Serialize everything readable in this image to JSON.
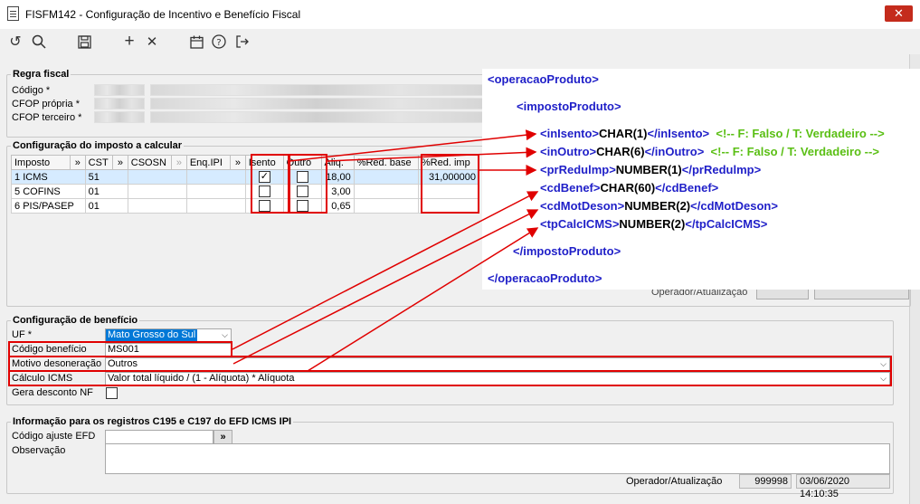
{
  "window": {
    "title": "FISFM142 - Configuração de Incentivo e Benefício Fiscal",
    "close_glyph": "✕"
  },
  "toolbar": {
    "undo": "↺",
    "search": "⚲",
    "save": "💾",
    "add": "+",
    "delete": "✕",
    "calendar": "📅",
    "help": "?",
    "exit": "⇥"
  },
  "regra": {
    "title": "Regra fiscal",
    "codigo_label": "Código *",
    "cfop_propria_label": "CFOP própria *",
    "cfop_terceiro_label": "CFOP terceiro *"
  },
  "imposto": {
    "title": "Configuração do imposto a calcular",
    "columns": [
      "Imposto",
      "»",
      "CST",
      "»",
      "CSOSN",
      "»",
      "Enq.IPI",
      "»",
      "Isento",
      "Outro",
      "Aliq.",
      "%Red. base",
      "%Red. imp"
    ],
    "rows": [
      {
        "n": "1",
        "imposto": "ICMS",
        "cst": "51",
        "csosn": "",
        "enq": "",
        "isento": true,
        "outro": false,
        "aliq": "18,00",
        "red_base": "",
        "red_imp": "31,000000"
      },
      {
        "n": "5",
        "imposto": "COFINS",
        "cst": "01",
        "csosn": "",
        "enq": "",
        "isento": false,
        "outro": false,
        "aliq": "3,00",
        "red_base": "",
        "red_imp": ""
      },
      {
        "n": "6",
        "imposto": "PIS/PASEP",
        "cst": "01",
        "csosn": "",
        "enq": "",
        "isento": false,
        "outro": false,
        "aliq": "0,65",
        "red_base": "",
        "red_imp": ""
      }
    ],
    "operador_label": "Operador/Atualização"
  },
  "xml": {
    "line1": "<operacaoProduto>",
    "line2": "<impostoProduto>",
    "inIsento": {
      "open": "<inIsento>",
      "type": "CHAR(1)",
      "close": "</inIsento>",
      "comment": "<!-- F: Falso / T: Verdadeiro -->"
    },
    "inOutro": {
      "open": "<inOutro>",
      "type": "CHAR(6)",
      "close": "</inOutro>",
      "comment": "<!-- F: Falso / T: Verdadeiro -->"
    },
    "prRedulmp": {
      "open": "<prRedulmp>",
      "type": "NUMBER(1)",
      "close": "</prRedulmp>"
    },
    "cdBenef": {
      "open": "<cdBenef>",
      "type": "CHAR(60)",
      "close": "</cdBenef>"
    },
    "cdMotDeson": {
      "open": "<cdMotDeson>",
      "type": "NUMBER(2)",
      "close": "</cdMotDeson>"
    },
    "tpCalcICMS": {
      "open": "<tpCalcICMS>",
      "type": "NUMBER(2)",
      "close": "</tpCalcICMS>"
    },
    "line9": "</impostoProduto>",
    "line10": "</operacaoProduto>"
  },
  "beneficio": {
    "title": "Configuração de benefício",
    "uf_label": "UF *",
    "uf_value": "Mato Grosso do Sul",
    "codigo_label": "Código benefício",
    "codigo_value": "MS001",
    "motivo_label": "Motivo desoneração",
    "motivo_value": "Outros",
    "calculo_label": "Cálculo ICMS",
    "calculo_value": "Valor total líquido / (1 - Alíquota) * Alíquota",
    "gera_label": "Gera desconto NF"
  },
  "efd": {
    "title": "Informação para os registros C195 e C197 do EFD ICMS IPI",
    "codigo_label": "Código ajuste EFD",
    "lookup": "»",
    "obs_label": "Observação",
    "operador_label": "Operador/Atualização",
    "operador_value": "999998",
    "data_value": "03/06/2020 14:10:35"
  },
  "colors": {
    "accent_red": "#e00000",
    "xml_tag": "#1f1fc8",
    "xml_comment": "#5abf14",
    "selection": "#0078d7"
  }
}
